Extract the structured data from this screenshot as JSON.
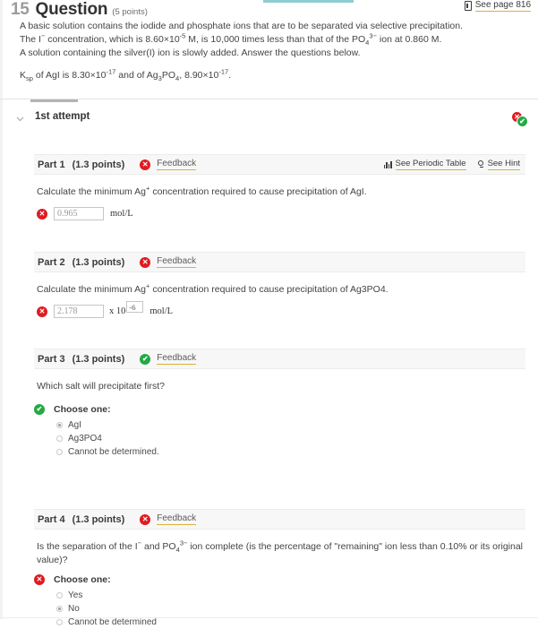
{
  "header": {
    "number": "15",
    "title": "Question",
    "points": "(5 points)",
    "see_page_label": "See page 816",
    "book_icon": "book-icon"
  },
  "question": {
    "line1": "A basic solution contains the iodide and phosphate ions that are to be separated via selective precipitation.",
    "line2_a": "The I",
    "line2_sup1": "−",
    "line2_b": " concentration, which is 8.60×10",
    "line2_sup2": "-5",
    "line2_c": " M, is 10,000 times less than that of the PO",
    "line2_sub1": "4",
    "line2_sup3": "3−",
    "line2_d": " ion at 0.860 M.",
    "line3": "A solution containing the silver(I) ion is slowly added. Answer the questions below.",
    "ksp_a": "K",
    "ksp_sub": "sp",
    "ksp_b": " of AgI is 8.30×10",
    "ksp_sup1": "-17",
    "ksp_c": " and of Ag",
    "ksp_sub2": "3",
    "ksp_d": "PO",
    "ksp_sub3": "4",
    "ksp_e": ", 8.90×10",
    "ksp_sup2": "-17",
    "ksp_f": "."
  },
  "attempt": {
    "label": "1st attempt",
    "chevron": "chevron-down-icon",
    "status_wrong": "✕",
    "status_correct": "✔"
  },
  "tools": {
    "periodic_table": "See Periodic Table",
    "hint": "See Hint",
    "periodic_icon": "bar-chart-icon",
    "hint_icon": "lightbulb-icon"
  },
  "feedback_label": "Feedback",
  "parts": [
    {
      "title": "Part 1",
      "points": "(1.3 points)",
      "status": "incorrect",
      "status_glyph": "✕",
      "question_a": "Calculate the minimum Ag",
      "question_sup": "+",
      "question_b": " concentration required to cause precipitation of AgI.",
      "answer_value": "0.965",
      "unit": "mol/L"
    },
    {
      "title": "Part 2",
      "points": "(1.3 points)",
      "status": "incorrect",
      "status_glyph": "✕",
      "question_a": "Calculate the minimum Ag",
      "question_sup": "+",
      "question_b": " concentration required to cause precipitation of Ag3PO4.",
      "answer_value": "2.178",
      "x10_label": "x 10",
      "exponent_value": "-6",
      "unit": "mol/L"
    },
    {
      "title": "Part 3",
      "points": "(1.3 points)",
      "status": "correct",
      "status_glyph": "✔",
      "question": "Which salt will precipitate first?",
      "choose_label": "Choose one:",
      "options": [
        {
          "label": "AgI",
          "selected": true
        },
        {
          "label": "Ag3PO4",
          "selected": false
        },
        {
          "label": "Cannot be determined.",
          "selected": false
        }
      ]
    },
    {
      "title": "Part 4",
      "points": "(1.3 points)",
      "status": "incorrect",
      "status_glyph": "✕",
      "question_a": "Is the separation of the I",
      "question_sup1": "−",
      "question_b": " and PO",
      "question_sub": "4",
      "question_sup2": "3−",
      "question_c": " ion complete (is the percentage of \"remaining\" ion less than 0.10% or its original value)?",
      "choose_label": "Choose one:",
      "options": [
        {
          "label": "Yes",
          "selected": false
        },
        {
          "label": "No",
          "selected": true
        },
        {
          "label": "Cannot be determined",
          "selected": false
        }
      ]
    }
  ],
  "colors": {
    "incorrect": "#e01b22",
    "correct": "#22aa44",
    "link_underline": "#d9b23a",
    "tab_accent": "#8fcdd2"
  }
}
